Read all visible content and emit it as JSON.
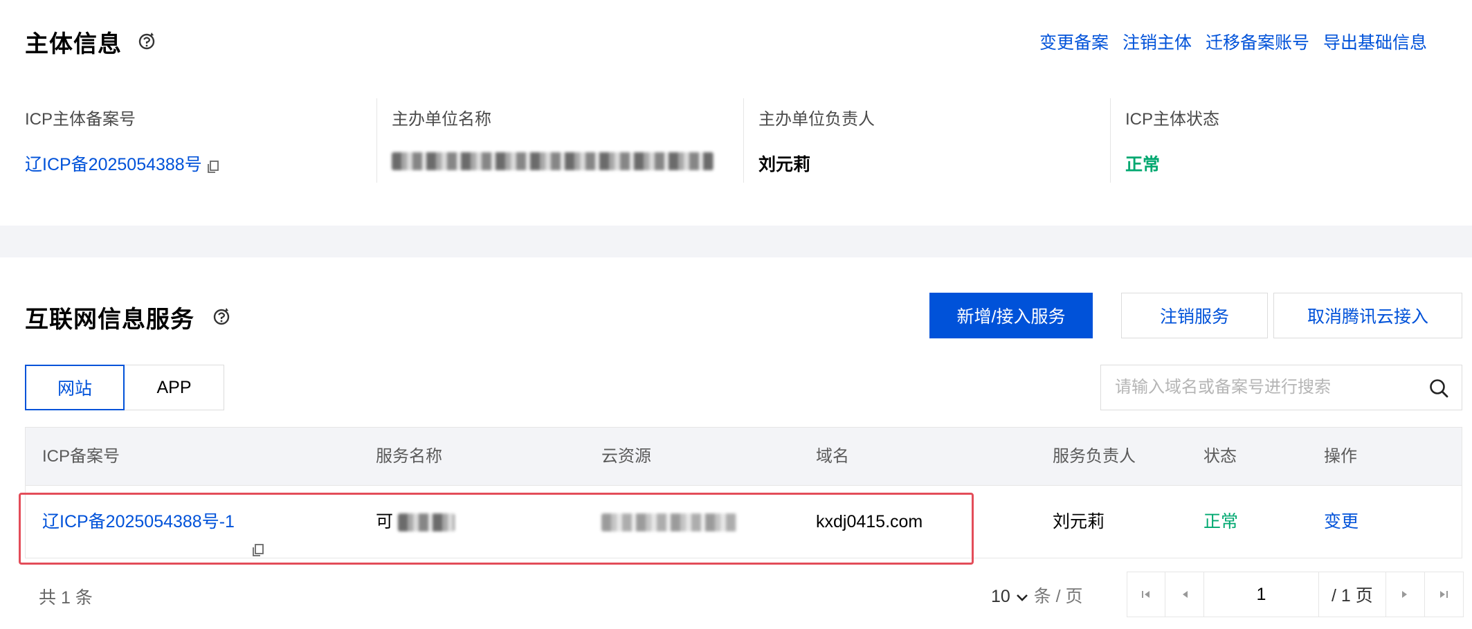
{
  "subject": {
    "title": "主体信息",
    "actions": [
      "变更备案",
      "注销主体",
      "迁移备案账号",
      "导出基础信息"
    ],
    "fields": [
      {
        "label": "ICP主体备案号",
        "value": "辽ICP备2025054388号"
      },
      {
        "label": "主办单位名称",
        "value": ""
      },
      {
        "label": "主办单位负责人",
        "value": "刘元莉"
      },
      {
        "label": "ICP主体状态",
        "value": "正常"
      }
    ]
  },
  "services": {
    "title": "互联网信息服务",
    "buttons": {
      "add": "新增/接入服务",
      "cancel": "注销服务",
      "cancel_access": "取消腾讯云接入"
    },
    "tabs": [
      {
        "label": "网站",
        "active": true
      },
      {
        "label": "APP",
        "active": false
      }
    ],
    "search": {
      "placeholder": "请输入域名或备案号进行搜索"
    },
    "table": {
      "headers": [
        "ICP备案号",
        "服务名称",
        "云资源",
        "域名",
        "服务负责人",
        "状态",
        "操作"
      ],
      "rows": [
        {
          "icp": "辽ICP备2025054388号-1",
          "service_name": "可",
          "cloud_resource": "",
          "domain": "kxdj0415.com",
          "owner": "刘元莉",
          "status": "正常",
          "action": "变更"
        }
      ]
    },
    "footer": {
      "total": "共 1 条",
      "page_size": "10",
      "page_size_unit": "条 / 页",
      "current_page": "1",
      "total_pages": "/ 1 页"
    }
  },
  "colors": {
    "accent": "#0052d9",
    "success": "#00a870",
    "highlight": "#e34d59"
  }
}
